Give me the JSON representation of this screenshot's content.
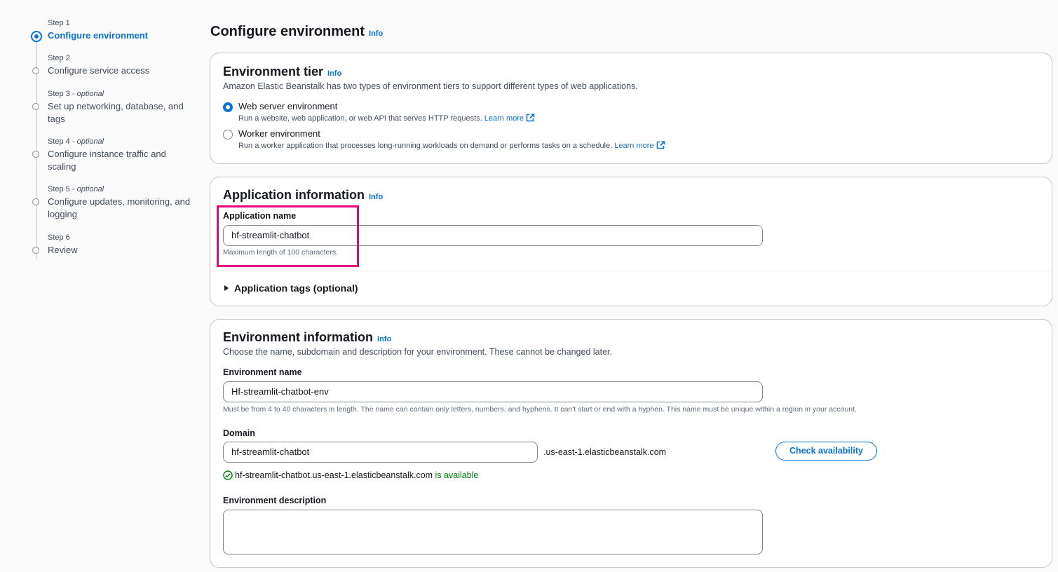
{
  "steps": [
    {
      "num": "Step 1",
      "optional": "",
      "label": "Configure environment",
      "active": true
    },
    {
      "num": "Step 2",
      "optional": "",
      "label": "Configure service access"
    },
    {
      "num": "Step 3",
      "optional": " - optional",
      "label": "Set up networking, database, and tags"
    },
    {
      "num": "Step 4",
      "optional": " - optional",
      "label": "Configure instance traffic and scaling"
    },
    {
      "num": "Step 5",
      "optional": " - optional",
      "label": "Configure updates, monitoring, and logging"
    },
    {
      "num": "Step 6",
      "optional": "",
      "label": "Review"
    }
  ],
  "page": {
    "title": "Configure environment",
    "info": "Info"
  },
  "tier": {
    "title": "Environment tier",
    "info": "Info",
    "description": "Amazon Elastic Beanstalk has two types of environment tiers to support different types of web applications.",
    "options": [
      {
        "label": "Web server environment",
        "desc": "Run a website, web application, or web API that serves HTTP requests.",
        "link": "Learn more",
        "checked": true
      },
      {
        "label": "Worker environment",
        "desc": "Run a worker application that processes long-running workloads on demand or performs tasks on a schedule.",
        "link": "Learn more",
        "checked": false
      }
    ]
  },
  "app": {
    "title": "Application information",
    "info": "Info",
    "name_label": "Application name",
    "name_value": "hf-streamlit-chatbot",
    "name_hint": "Maximum length of 100 characters.",
    "tags_label": "Application tags (optional)"
  },
  "env": {
    "title": "Environment information",
    "info": "Info",
    "description": "Choose the name, subdomain and description for your environment. These cannot be changed later.",
    "name_label": "Environment name",
    "name_value": "Hf-streamlit-chatbot-env",
    "name_hint": "Must be from 4 to 40 characters in length. The name can contain only letters, numbers, and hyphens. It can't start or end with a hyphen. This name must be unique within a region in your account.",
    "domain_label": "Domain",
    "domain_value": "hf-streamlit-chatbot",
    "domain_suffix": ".us-east-1.elasticbeanstalk.com",
    "check_button": "Check availability",
    "availability_domain": "hf-streamlit-chatbot.us-east-1.elasticbeanstalk.com",
    "availability_status": "is available",
    "desc_label": "Environment description",
    "desc_value": ""
  },
  "colors": {
    "accent": "#0972d3",
    "success": "#037f0c",
    "highlight": "#e6007e"
  }
}
